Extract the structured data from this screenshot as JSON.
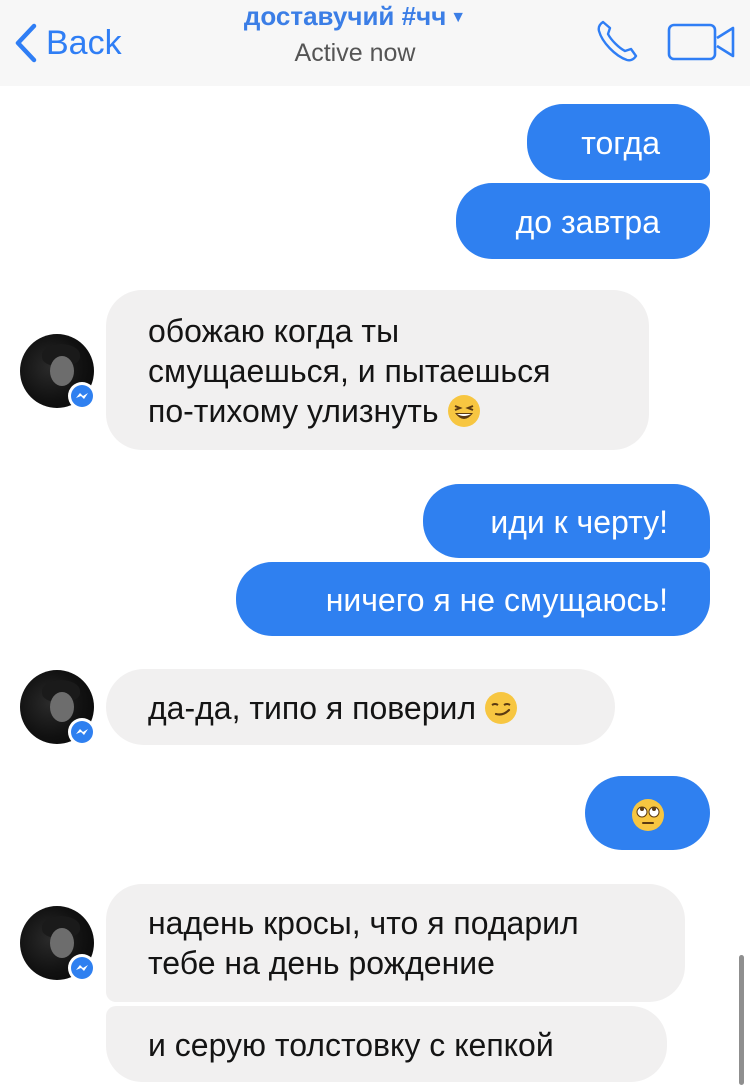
{
  "header": {
    "back_label": "Back",
    "title": "доставучий #чч",
    "status": "Active now"
  },
  "messages": [
    {
      "side": "out",
      "text": "тогда"
    },
    {
      "side": "out",
      "text": "до завтра"
    },
    {
      "side": "in",
      "lines": [
        "обожаю когда ты",
        "смущаешься, и пытаешься",
        "по-тихому улизнуть"
      ],
      "emoji": "laughing-face-emoji"
    },
    {
      "side": "out",
      "text": "иди к черту!"
    },
    {
      "side": "out",
      "text": "ничего я не смущаюсь!"
    },
    {
      "side": "in",
      "text": "да-да, типо я поверил",
      "emoji": "smirking-face-emoji"
    },
    {
      "side": "out",
      "emoji": "eye-roll-face-emoji"
    },
    {
      "side": "in",
      "lines": [
        "надень кросы, что я подарил",
        "тебе на день рождение"
      ]
    },
    {
      "side": "in",
      "text": "и серую толстовку с кепкой"
    }
  ],
  "colors": {
    "accent": "#2f7ef5",
    "outgoing_bubble": "#2f80f0",
    "incoming_bubble": "#f1f0f0",
    "header_bg": "#f7f7f7"
  }
}
